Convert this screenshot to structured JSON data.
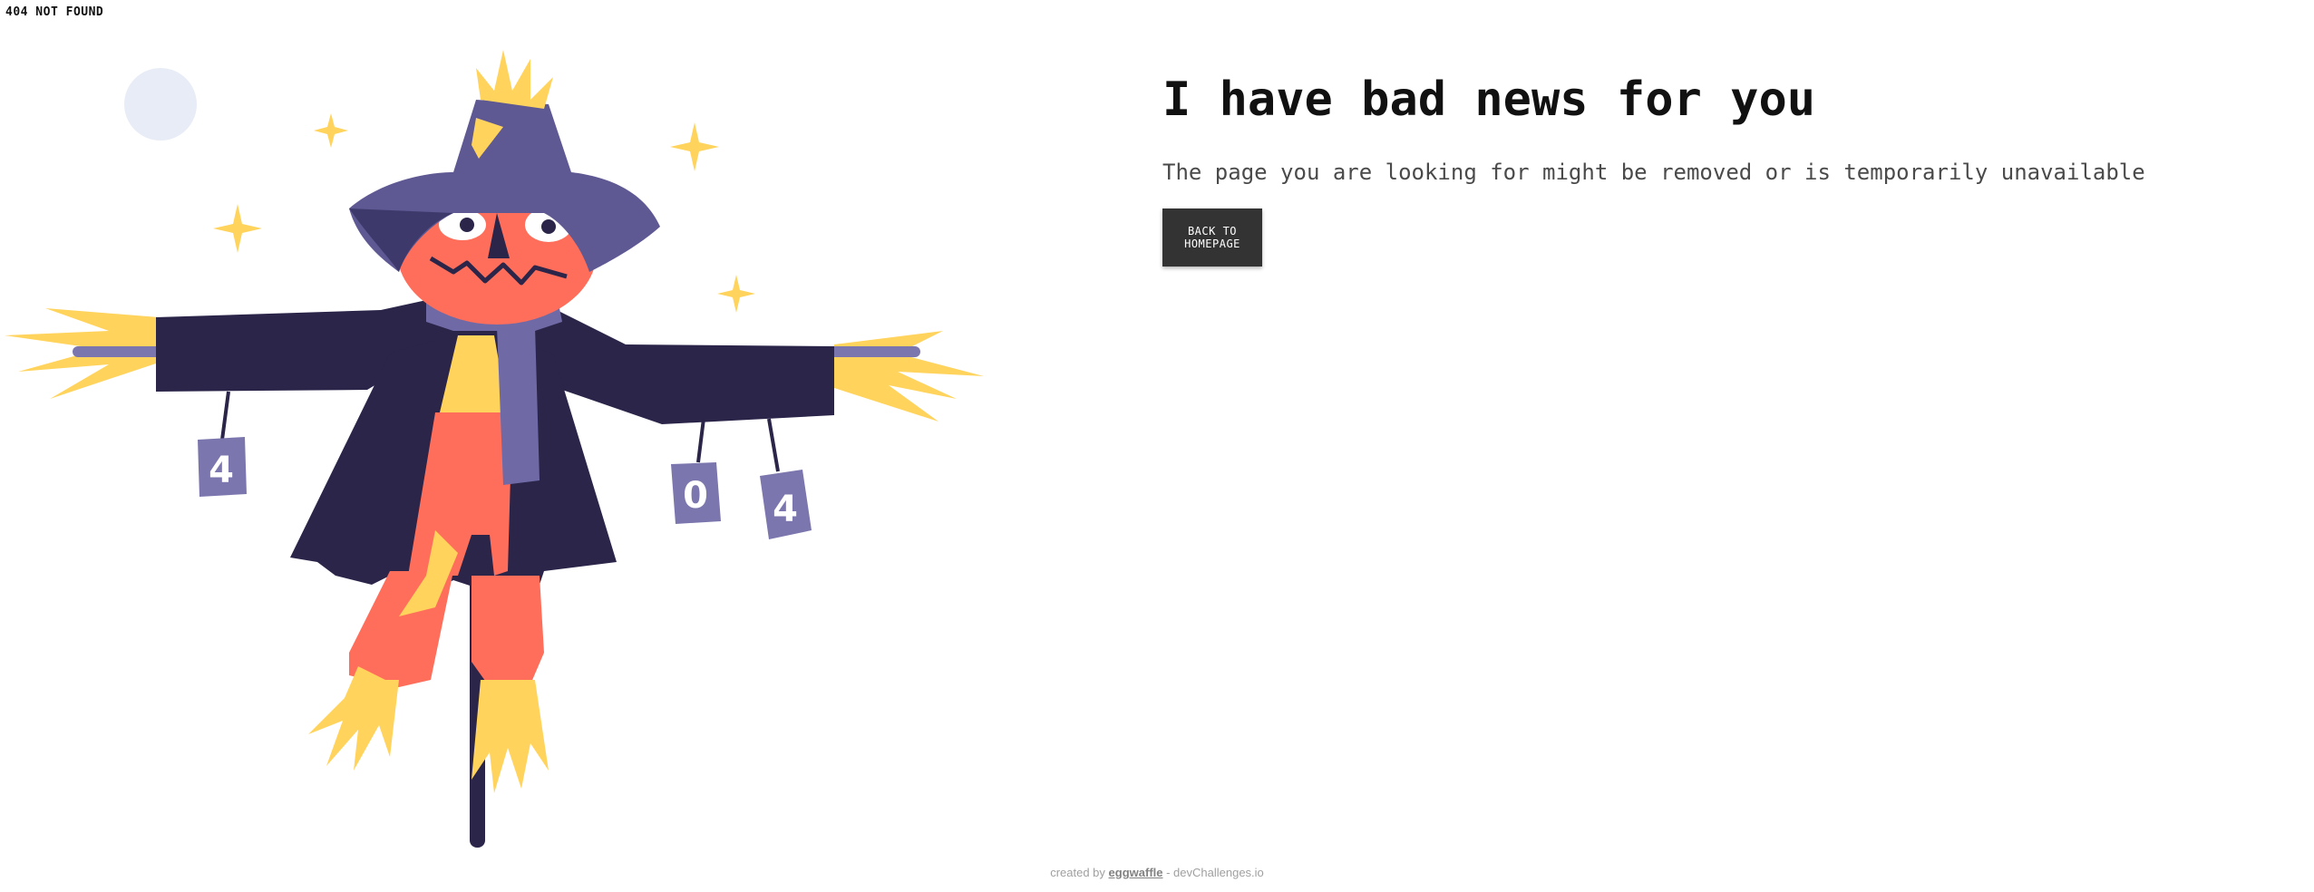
{
  "page": {
    "label": "404 NOT FOUND"
  },
  "illustration": {
    "can_digits": [
      "4",
      "0",
      "4"
    ],
    "colors": {
      "moon": "#e8ecf6",
      "star": "#ffd35c",
      "straw": "#ffd35c",
      "hat": "#5e5893",
      "hat_dark": "#3d3a6b",
      "face": "#ff6e5a",
      "coat": "#2b2549",
      "scarf": "#6f6aa6",
      "pants": "#ff6e5a",
      "pole": "#2b2549",
      "can": "#7b76ad"
    }
  },
  "main": {
    "headline": "I have bad news for you",
    "subtext": "The page you are looking for might be removed or is temporarily unavailable",
    "button_label": "BACK TO HOMEPAGE"
  },
  "footer": {
    "prefix": "created by",
    "author": "eggwaffle",
    "suffix": " - devChallenges.io"
  }
}
